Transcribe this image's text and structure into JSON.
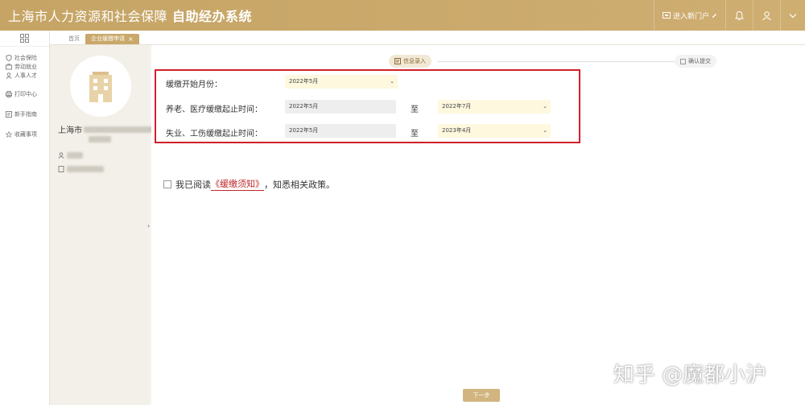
{
  "header": {
    "title_prefix": "上海市人力资源和社会保障",
    "title_bold": "自助经办系统",
    "portal_label": "进入新门户"
  },
  "nav": {
    "items": [
      {
        "label": "社会保险",
        "icon": "shield-icon"
      },
      {
        "label": "劳动就业",
        "icon": "briefcase-icon"
      },
      {
        "label": "人事人才",
        "icon": "user-icon"
      },
      {
        "label": "打印中心",
        "icon": "printer-icon"
      },
      {
        "label": "新手指南",
        "icon": "guide-icon"
      },
      {
        "label": "收藏事项",
        "icon": "star-icon"
      }
    ]
  },
  "tabs": [
    {
      "label": "首页",
      "active": false
    },
    {
      "label": "企业缓缴申请",
      "active": true
    }
  ],
  "user": {
    "name_prefix": "上海市"
  },
  "steps": [
    {
      "label": "信息录入",
      "active": true
    },
    {
      "label": "确认提交",
      "active": false
    }
  ],
  "form": {
    "start_month": {
      "label": "缓缴开始月份：",
      "value": "2022年5月"
    },
    "pension": {
      "label": "养老、医疗缓缴起止时间：",
      "from": "2022年5月",
      "sep": "至",
      "to": "2022年7月"
    },
    "unemployment": {
      "label": "失业、工伤缓缴起止时间：",
      "from": "2022年5月",
      "sep": "至",
      "to": "2023年4月"
    }
  },
  "agreement": {
    "prefix": "我已阅读",
    "link": "《缓缴须知》",
    "suffix": "，知悉相关政策。"
  },
  "next_button": "下一步",
  "watermark": "知乎 @魔都小沪",
  "colors": {
    "accent": "#c9a86a",
    "highlight": "#d0202a",
    "link": "#c0282a"
  }
}
